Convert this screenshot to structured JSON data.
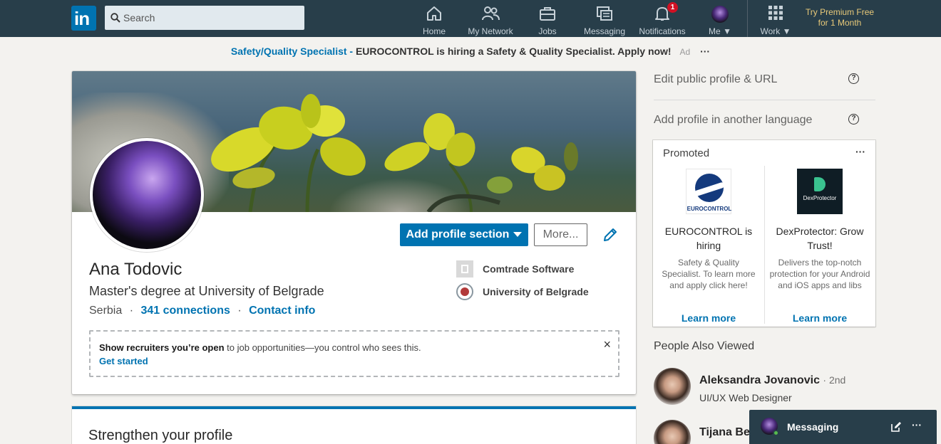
{
  "nav": {
    "logo": "in",
    "search_placeholder": "Search",
    "items": [
      {
        "label": "Home",
        "icon": "home-icon"
      },
      {
        "label": "My Network",
        "icon": "network-icon"
      },
      {
        "label": "Jobs",
        "icon": "briefcase-icon"
      },
      {
        "label": "Messaging",
        "icon": "chat-icon"
      },
      {
        "label": "Notifications",
        "icon": "bell-icon",
        "badge": "1"
      },
      {
        "label": "Me",
        "icon": "avatar"
      },
      {
        "label": "Work",
        "icon": "grid-icon"
      }
    ],
    "premium_line1": "Try Premium Free",
    "premium_line2": "for 1 Month"
  },
  "ad_banner": {
    "link": "Safety/Quality Specialist -",
    "text": "EUROCONTROL is hiring a Safety & Quality Specialist. Apply now!",
    "tag": "Ad",
    "more": "···"
  },
  "profile": {
    "add_section": "Add profile section",
    "more": "More...",
    "name": "Ana Todovic",
    "headline": "Master's degree at University of Belgrade",
    "location": "Serbia",
    "sep": "·",
    "connections": "341 connections",
    "contact": "Contact info",
    "experience": [
      {
        "name": "Comtrade Software"
      },
      {
        "name": "University of Belgrade"
      }
    ],
    "open_to": {
      "bold": "Show recruiters you’re open",
      "rest": " to job opportunities—you control who sees this.",
      "cta": "Get started",
      "close": "×"
    },
    "strengthen_title": "Strengthen your profile"
  },
  "rail": {
    "edit_url": "Edit public profile & URL",
    "add_language": "Add profile in another language",
    "help": "?",
    "promoted": {
      "title": "Promoted",
      "more": "···",
      "ads": [
        {
          "logo_text": "EUROCONTROL",
          "name": "EUROCONTROL is hiring",
          "desc": "Safety & Quality Specialist. To learn more and apply click here!",
          "cta": "Learn more"
        },
        {
          "logo_text": "DexProtector",
          "name": "DexProtector: Grow Trust!",
          "desc": "Delivers the top-notch protection for your Android and iOS apps and libs",
          "cta": "Learn more"
        }
      ]
    },
    "people_title": "People Also Viewed",
    "people": [
      {
        "name": "Aleksandra Jovanovic",
        "degree": "· 2nd",
        "title": "UI/UX Web Designer"
      },
      {
        "name": "Tijana Bek",
        "degree": "",
        "title": ""
      }
    ]
  },
  "messaging": {
    "label": "Messaging",
    "more": "···"
  },
  "colors": {
    "nav_bg": "#283e4a",
    "brand_blue": "#0073b1",
    "premium_gold": "#e8c979",
    "page_bg": "#f3f2ef"
  }
}
